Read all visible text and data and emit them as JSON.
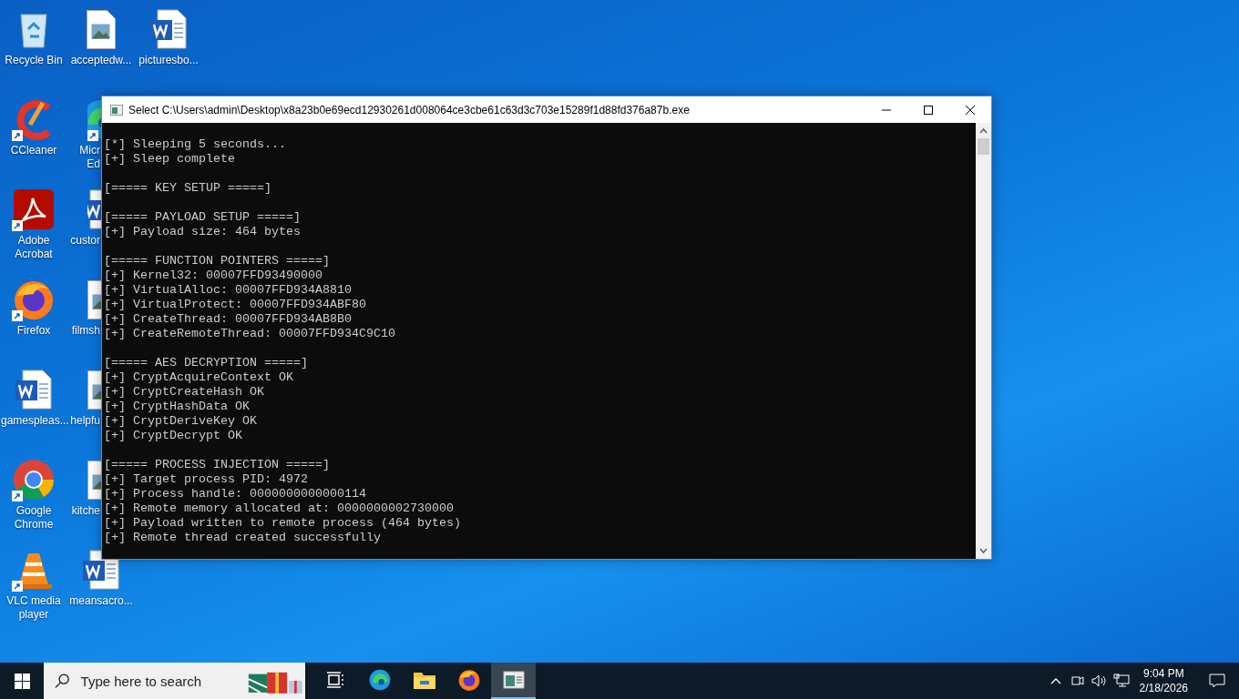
{
  "desktop": {
    "icons": [
      {
        "label": "Recycle Bin",
        "kind": "recycle",
        "shortcut": false,
        "covered": false
      },
      {
        "label": "CCleaner",
        "kind": "ccleaner",
        "shortcut": true,
        "covered": false
      },
      {
        "label": "Adobe Acrobat",
        "kind": "acrobat",
        "shortcut": true,
        "covered": false
      },
      {
        "label": "Firefox",
        "kind": "firefox",
        "shortcut": true,
        "covered": false
      },
      {
        "label": "gamespleas...",
        "kind": "word",
        "shortcut": false,
        "covered": false
      },
      {
        "label": "Google Chrome",
        "kind": "chrome",
        "shortcut": true,
        "covered": false
      },
      {
        "label": "VLC media player",
        "kind": "vlc",
        "shortcut": true,
        "covered": false
      },
      {
        "label": "acceptedw...",
        "kind": "image",
        "shortcut": false,
        "covered": false
      },
      {
        "label": "Micr Ed",
        "kind": "edge",
        "shortcut": true,
        "covered": true
      },
      {
        "label": "custor",
        "kind": "word",
        "shortcut": false,
        "covered": true
      },
      {
        "label": "filmsh",
        "kind": "image",
        "shortcut": false,
        "covered": true
      },
      {
        "label": "helpfu",
        "kind": "image",
        "shortcut": false,
        "covered": true
      },
      {
        "label": "kitche",
        "kind": "image",
        "shortcut": false,
        "covered": true
      },
      {
        "label": "meansacro...",
        "kind": "word",
        "shortcut": false,
        "covered": false
      },
      {
        "label": "picturesbo...",
        "kind": "word",
        "shortcut": false,
        "covered": false
      }
    ]
  },
  "window": {
    "title": "Select C:\\Users\\admin\\Desktop\\x8a23b0e69ecd12930261d008064ce3cbe61c63d3c703e15289f1d88fd376a87b.exe",
    "blocks": [
      [
        "[*] Sleeping 5 seconds...",
        "[+] Sleep complete"
      ],
      [
        "[===== KEY SETUP =====]"
      ],
      [
        "[===== PAYLOAD SETUP =====]",
        "[+] Payload size: 464 bytes"
      ],
      [
        "[===== FUNCTION POINTERS =====]",
        "[+] Kernel32: 00007FFD93490000",
        "[+] VirtualAlloc: 00007FFD934A8810",
        "[+] VirtualProtect: 00007FFD934ABF80",
        "[+] CreateThread: 00007FFD934AB8B0",
        "[+] CreateRemoteThread: 00007FFD934C9C10"
      ],
      [
        "[===== AES DECRYPTION =====]",
        "[+] CryptAcquireContext OK",
        "[+] CryptCreateHash OK",
        "[+] CryptHashData OK",
        "[+] CryptDeriveKey OK",
        "[+] CryptDecrypt OK"
      ],
      [
        "[===== PROCESS INJECTION =====]",
        "[+] Target process PID: 4972",
        "[+] Process handle: 0000000000000114",
        "[+] Remote memory allocated at: 0000000002730000",
        "[+] Payload written to remote process (464 bytes)",
        "[+] Remote thread created successfully"
      ]
    ]
  },
  "taskbar": {
    "search": {
      "placeholder": "Type here to search"
    },
    "apps": [
      {
        "kind": "taskview",
        "selected": false
      },
      {
        "kind": "edge",
        "selected": false
      },
      {
        "kind": "explorer",
        "selected": false
      },
      {
        "kind": "firefox",
        "selected": false
      },
      {
        "kind": "console",
        "selected": true
      }
    ],
    "clock": {
      "time": "9:04 PM",
      "date": "2/18/2026"
    }
  }
}
